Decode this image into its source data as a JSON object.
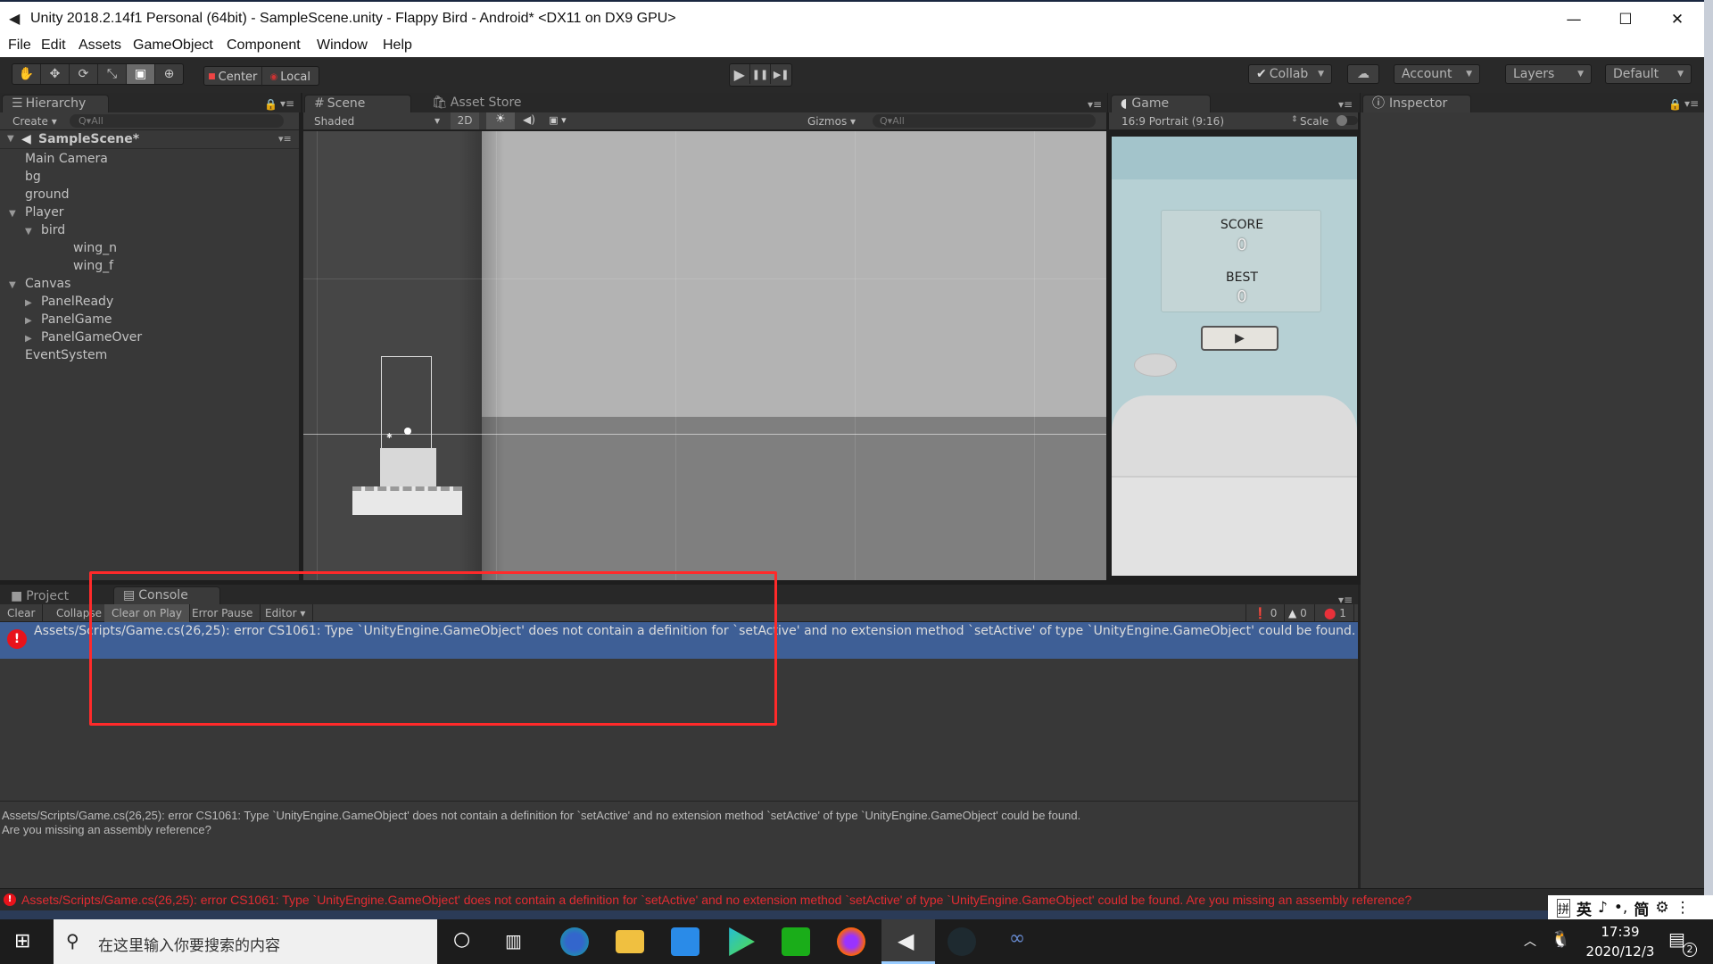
{
  "window": {
    "title": "Unity 2018.2.14f1 Personal (64bit) - SampleScene.unity - Flappy Bird - Android* <DX11 on DX9 GPU>",
    "controls": {
      "minimize": "—",
      "maximize": "☐",
      "close": "✕"
    }
  },
  "menu": [
    "File",
    "Edit",
    "Assets",
    "GameObject",
    "Component",
    "Window",
    "Help"
  ],
  "toolbar": {
    "tools": [
      {
        "name": "hand-tool",
        "glyph": "✋"
      },
      {
        "name": "move-tool",
        "glyph": "✥"
      },
      {
        "name": "rotate-tool",
        "glyph": "⟳"
      },
      {
        "name": "scale-tool",
        "glyph": "⤡"
      },
      {
        "name": "rect-tool",
        "glyph": "▣"
      },
      {
        "name": "transform-tool",
        "glyph": "⊕"
      }
    ],
    "active_tool": 4,
    "pivot": "Center",
    "space": "Local",
    "play": "▶",
    "pause": "❚❚",
    "step": "▶❚",
    "collab": "Collab",
    "cloud": "☁",
    "account": "Account",
    "layers": "Layers",
    "layout": "Default"
  },
  "hierarchy": {
    "tab": "Hierarchy",
    "create": "Create",
    "search_placeholder": "All",
    "scene": "SampleScene*",
    "items": [
      {
        "label": "Main Camera",
        "depth": 1,
        "arrow": ""
      },
      {
        "label": "bg",
        "depth": 1,
        "arrow": ""
      },
      {
        "label": "ground",
        "depth": 1,
        "arrow": ""
      },
      {
        "label": "Player",
        "depth": 1,
        "arrow": "▼"
      },
      {
        "label": "bird",
        "depth": 2,
        "arrow": "▼"
      },
      {
        "label": "wing_n",
        "depth": 3,
        "arrow": ""
      },
      {
        "label": "wing_f",
        "depth": 3,
        "arrow": ""
      },
      {
        "label": "Canvas",
        "depth": 1,
        "arrow": "▼"
      },
      {
        "label": "PanelReady",
        "depth": 2,
        "arrow": "▶"
      },
      {
        "label": "PanelGame",
        "depth": 2,
        "arrow": "▶"
      },
      {
        "label": "PanelGameOver",
        "depth": 2,
        "arrow": "▶"
      },
      {
        "label": "EventSystem",
        "depth": 1,
        "arrow": ""
      }
    ]
  },
  "scene": {
    "tab": "Scene",
    "asset_store_tab": "Asset Store",
    "shading": "Shaded",
    "mode_2d": "2D",
    "gizmos": "Gizmos",
    "search_placeholder": "All"
  },
  "game": {
    "tab": "Game",
    "aspect": "16:9 Portrait (9:16)",
    "scale_label": "Scale",
    "score_label": "SCORE",
    "score_value": "0",
    "best_label": "BEST",
    "best_value": "0",
    "play_glyph": "▶"
  },
  "inspector": {
    "tab": "Inspector"
  },
  "console": {
    "project_tab": "Project",
    "console_tab": "Console",
    "buttons": [
      "Clear",
      "Collapse",
      "Clear on Play",
      "Error Pause",
      "Editor"
    ],
    "counts": {
      "info": "0",
      "warning": "0",
      "error": "1"
    },
    "entries": [
      {
        "type": "error",
        "text": "Assets/Scripts/Game.cs(26,25): error CS1061: Type `UnityEngine.GameObject' does not contain a definition for `setActive' and no extension method `setActive' of type `UnityEngine.GameObject' could be found. Are you missing an assembly reference?"
      }
    ],
    "detail_line1": "Assets/Scripts/Game.cs(26,25): error CS1061: Type `UnityEngine.GameObject' does not contain a definition for `setActive' and no extension method `setActive' of type `UnityEngine.GameObject' could be found.",
    "detail_line2": "Are you missing an assembly reference?"
  },
  "statusbar": {
    "text": "Assets/Scripts/Game.cs(26,25): error CS1061: Type `UnityEngine.GameObject' does not contain a definition for `setActive' and no extension method `setActive' of type `UnityEngine.GameObject' could be found. Are you missing an assembly reference?"
  },
  "ime": {
    "items": [
      "拼",
      "英",
      "♪",
      "•,",
      "简",
      "⚙",
      "⋮"
    ]
  },
  "taskbar": {
    "search_placeholder": "在这里输入你要搜索的内容",
    "apps": [
      "cortana",
      "task-view",
      "edge",
      "file-explorer",
      "mail",
      "media-player",
      "wechat",
      "firefox",
      "unity",
      "unity-hub",
      "visual-studio"
    ],
    "time": "17:39",
    "date": "2020/12/3",
    "notifications": "2"
  },
  "colors": {
    "selection": "#3e5f96",
    "error_red": "#e8313a",
    "annotation_red": "#ff2a2a",
    "game_sky": "#a3c4cb"
  }
}
